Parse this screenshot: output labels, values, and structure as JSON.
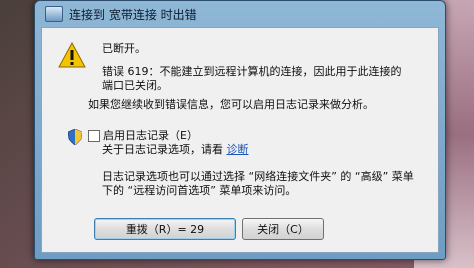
{
  "window": {
    "title": "连接到 宽带连接 时出错"
  },
  "dialog": {
    "status": "已断开。",
    "error_line1": "错误 619：不能建立到远程计算机的连接，因此用于此连接的",
    "error_line2": "端口已关闭。",
    "help_line": "如果您继续收到错误信息，您可以启用日志记录来做分析。",
    "logging_checkbox_label": "启用日志记录（E）",
    "about_logging_text": "关于日志记录选项，请看",
    "about_logging_link": "诊断",
    "info_line1": "日志记录选项也可以通过选择 “网络连接文件夹” 的 “高级” 菜单",
    "info_line2": "下的 “远程访问首选项” 菜单项来访问。",
    "logging_enabled": false
  },
  "buttons": {
    "redial": "重拨（R）= 29",
    "close": "关闭（C）"
  },
  "icons": {
    "title": "network-connection-icon",
    "warning": "warning-icon",
    "shield": "uac-shield-icon"
  }
}
